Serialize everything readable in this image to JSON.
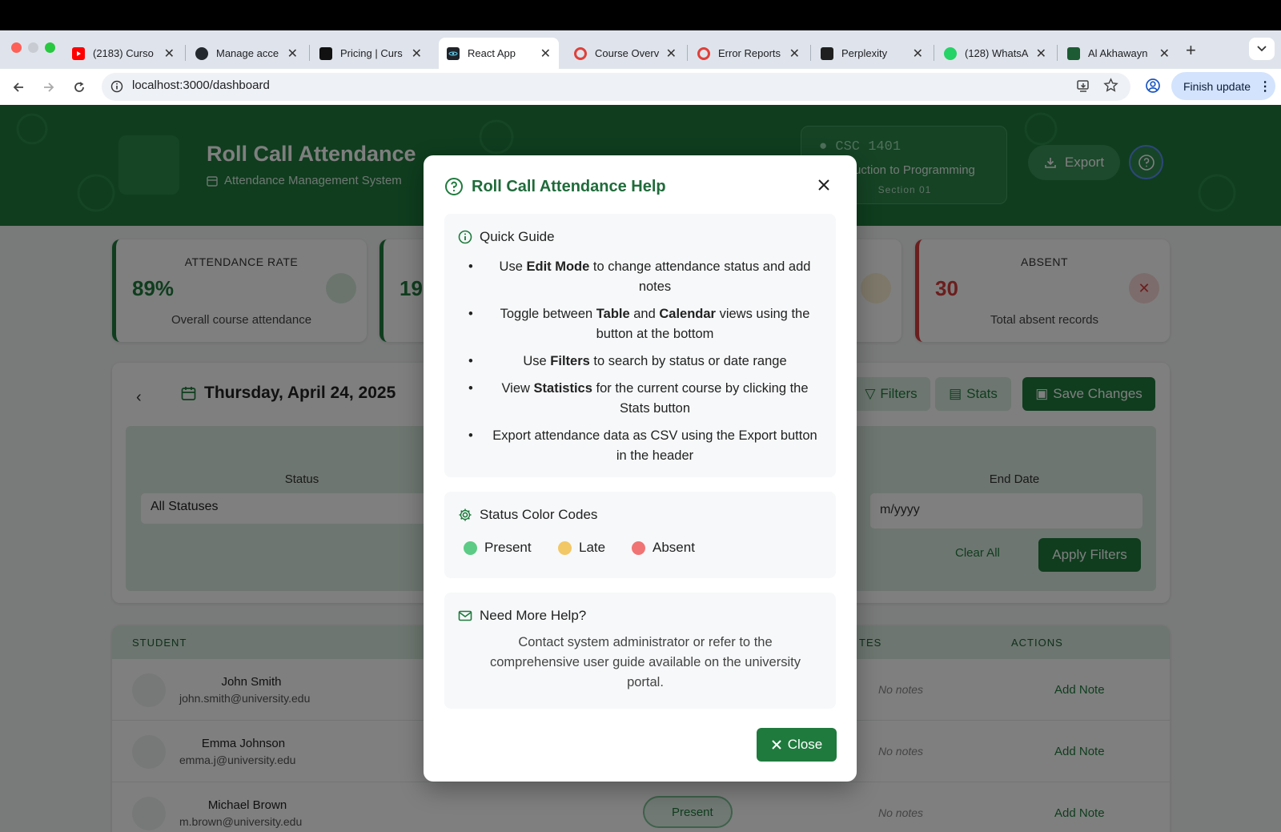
{
  "browser": {
    "tabs": [
      {
        "title": "(2183) Curso"
      },
      {
        "title": "Manage acce"
      },
      {
        "title": "Pricing | Curs"
      },
      {
        "title": "React App"
      },
      {
        "title": "Course Overv"
      },
      {
        "title": "Error Reports"
      },
      {
        "title": "Perplexity"
      },
      {
        "title": "(128) WhatsA"
      },
      {
        "title": "Al Akhawayn"
      }
    ],
    "url": "localhost:3000/dashboard",
    "finish_update_label": "Finish update"
  },
  "header": {
    "title": "Roll Call Attendance",
    "subtitle": "Attendance Management System",
    "course_code": "CSC 1401",
    "course_name": "uction to Programming",
    "section": "Section 01",
    "export_label": "Export"
  },
  "stats": {
    "rate_label": "ATTENDANCE RATE",
    "rate_value": "89%",
    "rate_desc": "Overall course attendance",
    "second_value": "19",
    "absent_label": "ABSENT",
    "absent_value": "30",
    "absent_desc": "Total absent records"
  },
  "toolbar": {
    "date": "Thursday, April 24, 2025",
    "filters_label": "Filters",
    "stats_label": "Stats",
    "save_label": "Save Changes"
  },
  "filters": {
    "status_label": "Status",
    "status_value": "All Statuses",
    "end_date_label": "End Date",
    "end_date_placeholder": "m/yyyy",
    "clear_label": "Clear All",
    "apply_label": "Apply Filters"
  },
  "table": {
    "col_student": "STUDENT",
    "col_notes": "TES",
    "col_actions": "ACTIONS",
    "rows": [
      {
        "name": "John Smith",
        "email": "john.smith@university.edu",
        "notes": "No notes",
        "action": "Add Note"
      },
      {
        "name": "Emma Johnson",
        "email": "emma.j@university.edu",
        "notes": "No notes",
        "action": "Add Note"
      },
      {
        "name": "Michael Brown",
        "email": "m.brown@university.edu",
        "status": "Present",
        "notes": "No notes",
        "action": "Add Note"
      }
    ]
  },
  "modal": {
    "title": "Roll Call Attendance Help",
    "quick_guide_title": "Quick Guide",
    "guide": [
      {
        "pre": "Use ",
        "b1": "Edit Mode",
        "mid": " to change attendance status and add notes",
        "b2": "",
        "post": ""
      },
      {
        "pre": "Toggle between ",
        "b1": "Table",
        "mid": " and ",
        "b2": "Calendar",
        "post": " views using the button at the bottom"
      },
      {
        "pre": "Use ",
        "b1": "Filters",
        "mid": " to search by status or date range",
        "b2": "",
        "post": ""
      },
      {
        "pre": "View ",
        "b1": "Statistics",
        "mid": " for the current course by clicking the Stats button",
        "b2": "",
        "post": ""
      },
      {
        "pre": "Export attendance data as CSV using the Export button in the header",
        "b1": "",
        "mid": "",
        "b2": "",
        "post": ""
      }
    ],
    "color_codes_title": "Status Color Codes",
    "legend": [
      {
        "label": "Present",
        "color": "#5ccb85"
      },
      {
        "label": "Late",
        "color": "#f2c766"
      },
      {
        "label": "Absent",
        "color": "#f07474"
      }
    ],
    "help_title": "Need More Help?",
    "help_text": "Contact system administrator or refer to the comprehensive user guide available on the university portal.",
    "close_label": "Close"
  }
}
